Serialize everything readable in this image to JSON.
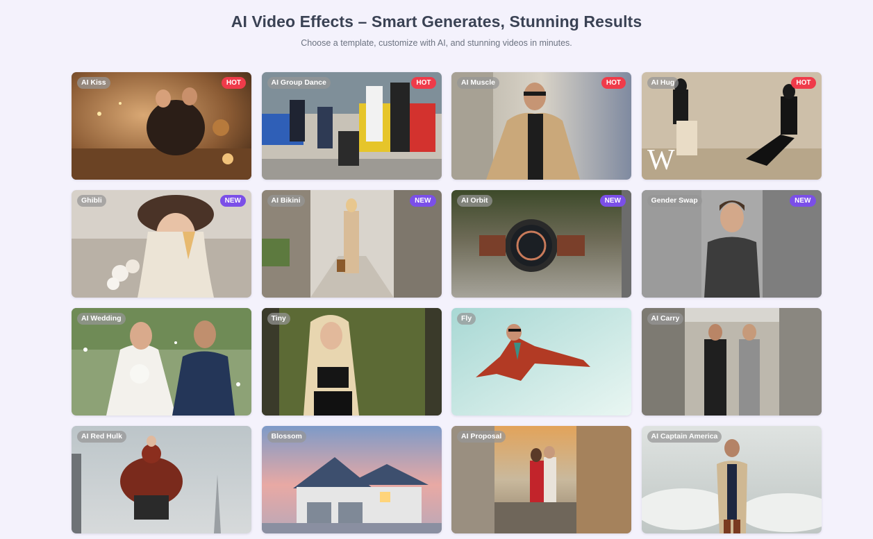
{
  "header": {
    "title": "AI Video Effects – Smart Generates, Stunning Results",
    "subtitle": "Choose a template, customize with AI, and stunning videos in minutes."
  },
  "colors": {
    "hot": "#ef3b4a",
    "new": "#7b4fe8",
    "page_bg": "#f4f2fc"
  },
  "cards": [
    {
      "label": "AI Kiss",
      "badge": "HOT",
      "scene": "couple-candles"
    },
    {
      "label": "AI Group Dance",
      "badge": "HOT",
      "scene": "group-street"
    },
    {
      "label": "AI Muscle",
      "badge": "HOT",
      "scene": "man-coat-street"
    },
    {
      "label": "AI Hug",
      "badge": "HOT",
      "scene": "two-seated-studio"
    },
    {
      "label": "Ghibli",
      "badge": "NEW",
      "scene": "woman-icecream"
    },
    {
      "label": "AI Bikini",
      "badge": "NEW",
      "scene": "woman-walking-street"
    },
    {
      "label": "AI Orbit",
      "badge": "NEW",
      "scene": "watch-gravel"
    },
    {
      "label": "Gender Swap",
      "badge": "NEW",
      "scene": "man-tshirt"
    },
    {
      "label": "AI Wedding",
      "badge": "",
      "scene": "wedding-couple"
    },
    {
      "label": "Tiny",
      "badge": "",
      "scene": "blonde-woman"
    },
    {
      "label": "Fly",
      "badge": "",
      "scene": "man-flying"
    },
    {
      "label": "AI Carry",
      "badge": "",
      "scene": "two-men-building"
    },
    {
      "label": "AI Red Hulk",
      "badge": "",
      "scene": "red-hulk-city"
    },
    {
      "label": "Blossom",
      "badge": "",
      "scene": "house-sunset"
    },
    {
      "label": "AI Proposal",
      "badge": "",
      "scene": "couple-beach"
    },
    {
      "label": "AI Captain America",
      "badge": "",
      "scene": "man-clouds"
    }
  ]
}
